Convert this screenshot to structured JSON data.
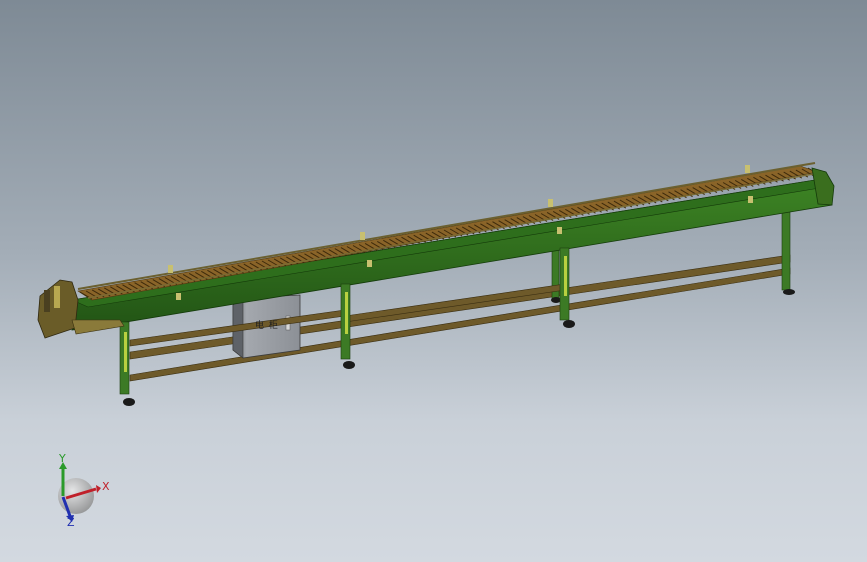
{
  "viewport": {
    "background_top": "#7e8a95",
    "background_bottom": "#d3d9e0"
  },
  "model": {
    "frame_color": "#2e6e1c",
    "frame_dark": "#1f4f13",
    "leg_color": "#3c7a25",
    "belt_color": "#8a6428",
    "rail_color": "#6e5a2a",
    "panel_color": "#8e929a",
    "panel_label": "电 柜"
  },
  "triad": {
    "x_label": "X",
    "y_label": "Y",
    "z_label": "Z",
    "x_color": "#c0202a",
    "y_color": "#2a9a2a",
    "z_color": "#2030b0"
  }
}
